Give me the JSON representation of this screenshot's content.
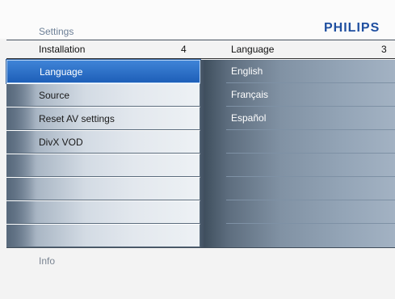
{
  "header": {
    "title": "Settings",
    "brand": "PHILIPS",
    "brand_color": "#1f4fa0"
  },
  "left_panel": {
    "heading": "Installation",
    "count": "4",
    "items": [
      {
        "label": "Language",
        "selected": true
      },
      {
        "label": "Source",
        "selected": false
      },
      {
        "label": "Reset AV settings",
        "selected": false
      },
      {
        "label": "DivX VOD",
        "selected": false
      }
    ],
    "selection_color": "#2f74cf"
  },
  "right_panel": {
    "heading": "Language",
    "count": "3",
    "options": [
      {
        "label": "English"
      },
      {
        "label": "Français"
      },
      {
        "label": "Español"
      }
    ]
  },
  "footer": {
    "info_label": "Info"
  }
}
